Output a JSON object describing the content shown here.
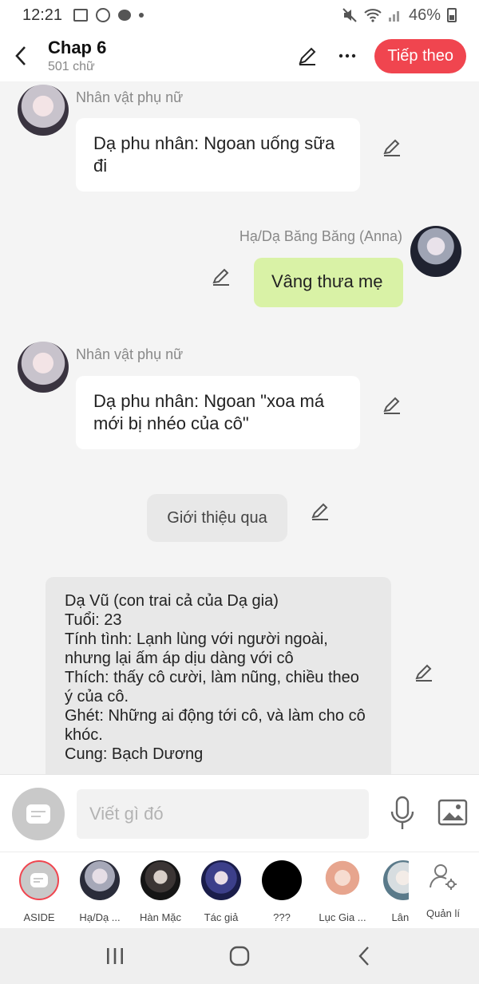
{
  "status_bar": {
    "time": "12:21",
    "battery": "46%",
    "icons": [
      "gallery-icon",
      "chrome-icon",
      "chat-icon",
      "dot-icon",
      "mute-icon",
      "wifi-icon",
      "signal-icon",
      "battery-icon"
    ]
  },
  "header": {
    "title": "Chap 6",
    "subtitle": "501 chữ",
    "next_label": "Tiếp theo"
  },
  "messages": [
    {
      "sender": "Nhân vật phụ nữ",
      "text": "Dạ phu nhân: Ngoan uống sữa đi",
      "side": "left"
    },
    {
      "sender": "Hạ/Dạ Băng Băng (Anna)",
      "text": "Vâng thưa mẹ",
      "side": "right"
    },
    {
      "sender": "Nhân vật phụ nữ",
      "text": "Dạ phu nhân: Ngoan \"xoa má mới bị nhéo của cô\"",
      "side": "left"
    },
    {
      "type": "narration",
      "text": "Giới thiệu qua"
    },
    {
      "type": "aside",
      "lines": [
        "Dạ Vũ (con trai cả của Dạ gia)",
        "Tuổi: 23",
        "Tính tình: Lạnh lùng với người ngoài,",
        "nhưng lại ấm áp dịu dàng với cô",
        "Thích: thấy cô cười, làm nũng, chiều theo",
        "ý của cô.",
        "Ghét: Những ai động tới cô, và làm cho cô",
        "khóc.",
        "Cung: Bạch Dương"
      ]
    }
  ],
  "input": {
    "placeholder": "Viết gì đó"
  },
  "characters": [
    {
      "label": "ASIDE"
    },
    {
      "label": "Hạ/Dạ ..."
    },
    {
      "label": "Hàn Mặc"
    },
    {
      "label": "Tác giả"
    },
    {
      "label": "???"
    },
    {
      "label": "Lục Gia ..."
    },
    {
      "label": "Lân I"
    }
  ],
  "manage_label": "Quản lí",
  "colors": {
    "accent": "#f0454f",
    "green_bubble": "#d9f2a6",
    "gray_bubble": "#e8e8e8"
  }
}
